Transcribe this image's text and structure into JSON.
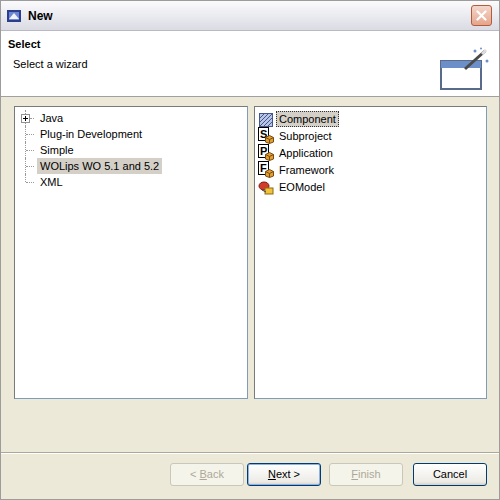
{
  "window": {
    "title": "New"
  },
  "header": {
    "title": "Select",
    "subtitle": "Select a wizard"
  },
  "categories": [
    {
      "label": "Java",
      "has_children": true,
      "expanded": false,
      "selected": false
    },
    {
      "label": "Plug-in Development",
      "has_children": false,
      "expanded": false,
      "selected": false
    },
    {
      "label": "Simple",
      "has_children": false,
      "expanded": false,
      "selected": false
    },
    {
      "label": "WOLips WO 5.1 and 5.2",
      "has_children": false,
      "expanded": false,
      "selected": true
    },
    {
      "label": "XML",
      "has_children": false,
      "expanded": false,
      "selected": false
    }
  ],
  "wizards": [
    {
      "label": "Component",
      "kind": "component",
      "selected": true
    },
    {
      "label": "Subproject",
      "kind": "lettered",
      "badge": "S",
      "selected": false
    },
    {
      "label": "Application",
      "kind": "lettered",
      "badge": "P",
      "selected": false
    },
    {
      "label": "Framework",
      "kind": "lettered",
      "badge": "F",
      "selected": false
    },
    {
      "label": "EOModel",
      "kind": "eomodel",
      "selected": false
    }
  ],
  "buttons": [
    {
      "label": "< Back",
      "disabled": true,
      "default": false,
      "mnemonic": 2
    },
    {
      "label": "Next >",
      "disabled": false,
      "default": true,
      "mnemonic": 0
    },
    {
      "label": "Finish",
      "disabled": true,
      "default": false,
      "mnemonic": 0
    },
    {
      "label": "Cancel",
      "disabled": false,
      "default": false,
      "mnemonic": -1
    }
  ]
}
